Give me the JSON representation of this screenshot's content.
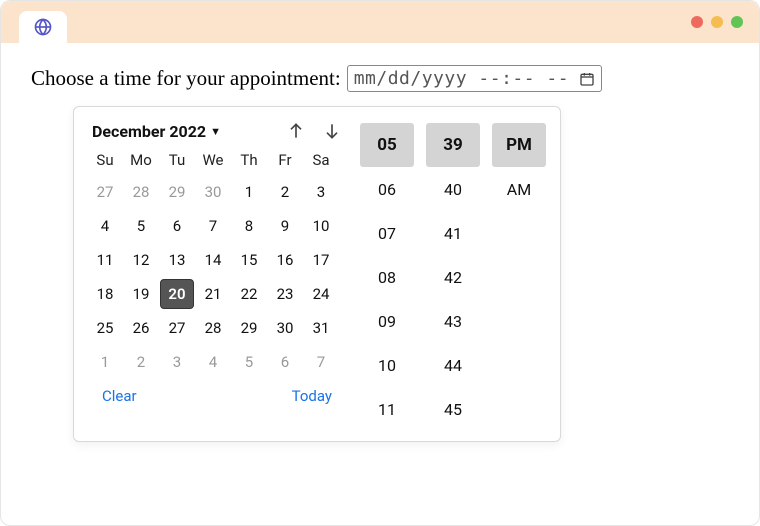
{
  "prompt": "Choose a time for your appointment:",
  "input": {
    "placeholder": "mm/dd/yyyy --:-- --"
  },
  "dt": {
    "month_label": "December 2022",
    "days_of_week": [
      "Su",
      "Mo",
      "Tu",
      "We",
      "Th",
      "Fr",
      "Sa"
    ],
    "weeks": [
      [
        {
          "n": "27",
          "out": true
        },
        {
          "n": "28",
          "out": true
        },
        {
          "n": "29",
          "out": true
        },
        {
          "n": "30",
          "out": true
        },
        {
          "n": "1"
        },
        {
          "n": "2"
        },
        {
          "n": "3"
        }
      ],
      [
        {
          "n": "4"
        },
        {
          "n": "5"
        },
        {
          "n": "6"
        },
        {
          "n": "7"
        },
        {
          "n": "8"
        },
        {
          "n": "9"
        },
        {
          "n": "10"
        }
      ],
      [
        {
          "n": "11"
        },
        {
          "n": "12"
        },
        {
          "n": "13"
        },
        {
          "n": "14"
        },
        {
          "n": "15"
        },
        {
          "n": "16"
        },
        {
          "n": "17"
        }
      ],
      [
        {
          "n": "18"
        },
        {
          "n": "19"
        },
        {
          "n": "20",
          "sel": true
        },
        {
          "n": "21"
        },
        {
          "n": "22"
        },
        {
          "n": "23"
        },
        {
          "n": "24"
        }
      ],
      [
        {
          "n": "25"
        },
        {
          "n": "26"
        },
        {
          "n": "27"
        },
        {
          "n": "28"
        },
        {
          "n": "29"
        },
        {
          "n": "30"
        },
        {
          "n": "31"
        }
      ],
      [
        {
          "n": "1",
          "out": true
        },
        {
          "n": "2",
          "out": true
        },
        {
          "n": "3",
          "out": true
        },
        {
          "n": "4",
          "out": true
        },
        {
          "n": "5",
          "out": true
        },
        {
          "n": "6",
          "out": true
        },
        {
          "n": "7",
          "out": true
        }
      ]
    ],
    "clear": "Clear",
    "today": "Today",
    "hours": [
      {
        "v": "05",
        "sel": true
      },
      {
        "v": "06"
      },
      {
        "v": "07"
      },
      {
        "v": "08"
      },
      {
        "v": "09"
      },
      {
        "v": "10"
      },
      {
        "v": "11"
      }
    ],
    "minutes": [
      {
        "v": "39",
        "sel": true
      },
      {
        "v": "40"
      },
      {
        "v": "41"
      },
      {
        "v": "42"
      },
      {
        "v": "43"
      },
      {
        "v": "44"
      },
      {
        "v": "45"
      }
    ],
    "ampm": [
      {
        "v": "PM",
        "sel": true
      },
      {
        "v": "AM"
      }
    ]
  }
}
